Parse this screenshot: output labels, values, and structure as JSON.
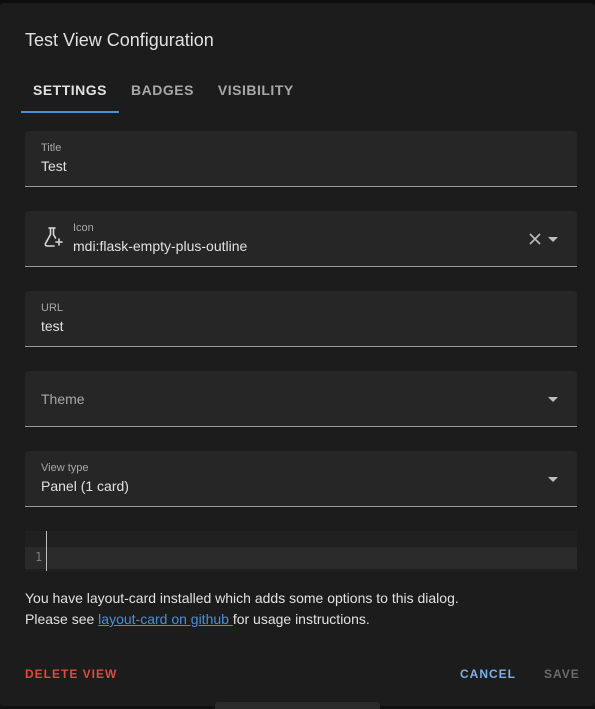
{
  "dialog": {
    "title": "Test View Configuration"
  },
  "tabs": [
    {
      "label": "SETTINGS",
      "active": true
    },
    {
      "label": "BADGES",
      "active": false
    },
    {
      "label": "VISIBILITY",
      "active": false
    }
  ],
  "fields": {
    "title": {
      "label": "Title",
      "value": "Test"
    },
    "icon": {
      "label": "Icon",
      "value": "mdi:flask-empty-plus-outline",
      "icon": "flask-empty-plus-outline-icon"
    },
    "url": {
      "label": "URL",
      "value": "test"
    },
    "theme": {
      "label": "Theme"
    },
    "view_type": {
      "label": "View type",
      "value": "Panel (1 card)"
    }
  },
  "editor": {
    "line_number": "1"
  },
  "info": {
    "line1": "You have layout-card installed which adds some options to this dialog.",
    "line2_prefix": "Please see ",
    "link_text": "layout-card on github ",
    "line2_suffix": "for usage instructions."
  },
  "actions": {
    "delete": "DELETE VIEW",
    "cancel": "CANCEL",
    "save": "SAVE"
  },
  "colors": {
    "accent": "#4a90d9",
    "danger": "#dc4b3e",
    "surface": "#1c1c1c",
    "field": "#262626"
  }
}
